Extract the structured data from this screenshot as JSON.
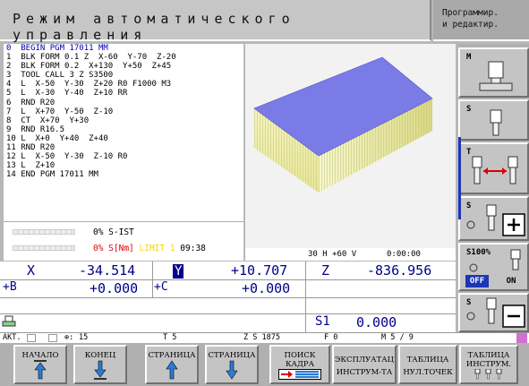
{
  "header": {
    "title": "Режим автоматического управления",
    "mode_line1": "Программир.",
    "mode_line2": "и редактир."
  },
  "program": {
    "lines": [
      "0  BEGIN PGM 17011 MM",
      "1  BLK FORM 0.1 Z  X-60  Y-70  Z-20",
      "2  BLK FORM 0.2  X+130  Y+50  Z+45",
      "3  TOOL CALL 3 Z S3500",
      "4  L  X-50  Y-30  Z+20 R0 F1000 M3",
      "5  L  X-30  Y-40  Z+10 RR",
      "6  RND R20",
      "7  L  X+70  Y-50  Z-10",
      "8  CT  X+70  Y+30",
      "9  RND R16.5",
      "10 L  X+0  Y+40  Z+40",
      "11 RND R20",
      "12 L  X-50  Y-30  Z-10 R0",
      "13 L  Z+10",
      "14 END PGM 17011 MM"
    ]
  },
  "status": {
    "line1": "0% S-IST",
    "line2_red": "0% S[Nm]",
    "line2_yellow": "LIMIT 1",
    "line2_time": "09:38"
  },
  "graphic": {
    "footer_left": "30 H +60 V",
    "footer_time": "0:00:00"
  },
  "positions": {
    "x_label": "X",
    "x_value": "-34.514",
    "y_label": "Y",
    "y_value": "+10.707",
    "z_label": "Z",
    "z_value": "-836.956",
    "b_label": "+B",
    "b_value": "+0.000",
    "c_label": "+C",
    "c_value": "+0.000",
    "s1_label": "S1",
    "s1_value": "0.000",
    "akt": "AKT.",
    "feed_override": "15",
    "tool": "T  5",
    "spindle": "Z S 1875",
    "feed": "F  0",
    "mfunc": "M 5 / 9"
  },
  "right_softkeys": {
    "m": "M",
    "s": "S",
    "t": "T",
    "s_plus": "S",
    "s100": "S100%",
    "off": "OFF",
    "on": "ON",
    "s_minus": "S"
  },
  "bottom_softkeys": [
    {
      "l1": "НАЧАЛО",
      "l2": ""
    },
    {
      "l1": "КОНЕЦ",
      "l2": ""
    },
    {
      "l1": "СТРАНИЦА",
      "l2": ""
    },
    {
      "l1": "СТРАНИЦА",
      "l2": ""
    },
    {
      "l1": "ПОИСК",
      "l2": "КАДРА"
    },
    {
      "l1": "ЭКСПЛУАТАЦ",
      "l2": "ИНСТРУМ-ТА"
    },
    {
      "l1": "ТАБЛИЦА",
      "l2": "НУЛ.ТОЧЕК"
    },
    {
      "l1": "ТАБЛИЦА",
      "l2": "ИНСТРУМ."
    }
  ],
  "colors": {
    "text_blue": "#00008a",
    "block_top": "#7b7be8",
    "limit_red": "#e00000",
    "limit_yellow": "#ffd400"
  }
}
